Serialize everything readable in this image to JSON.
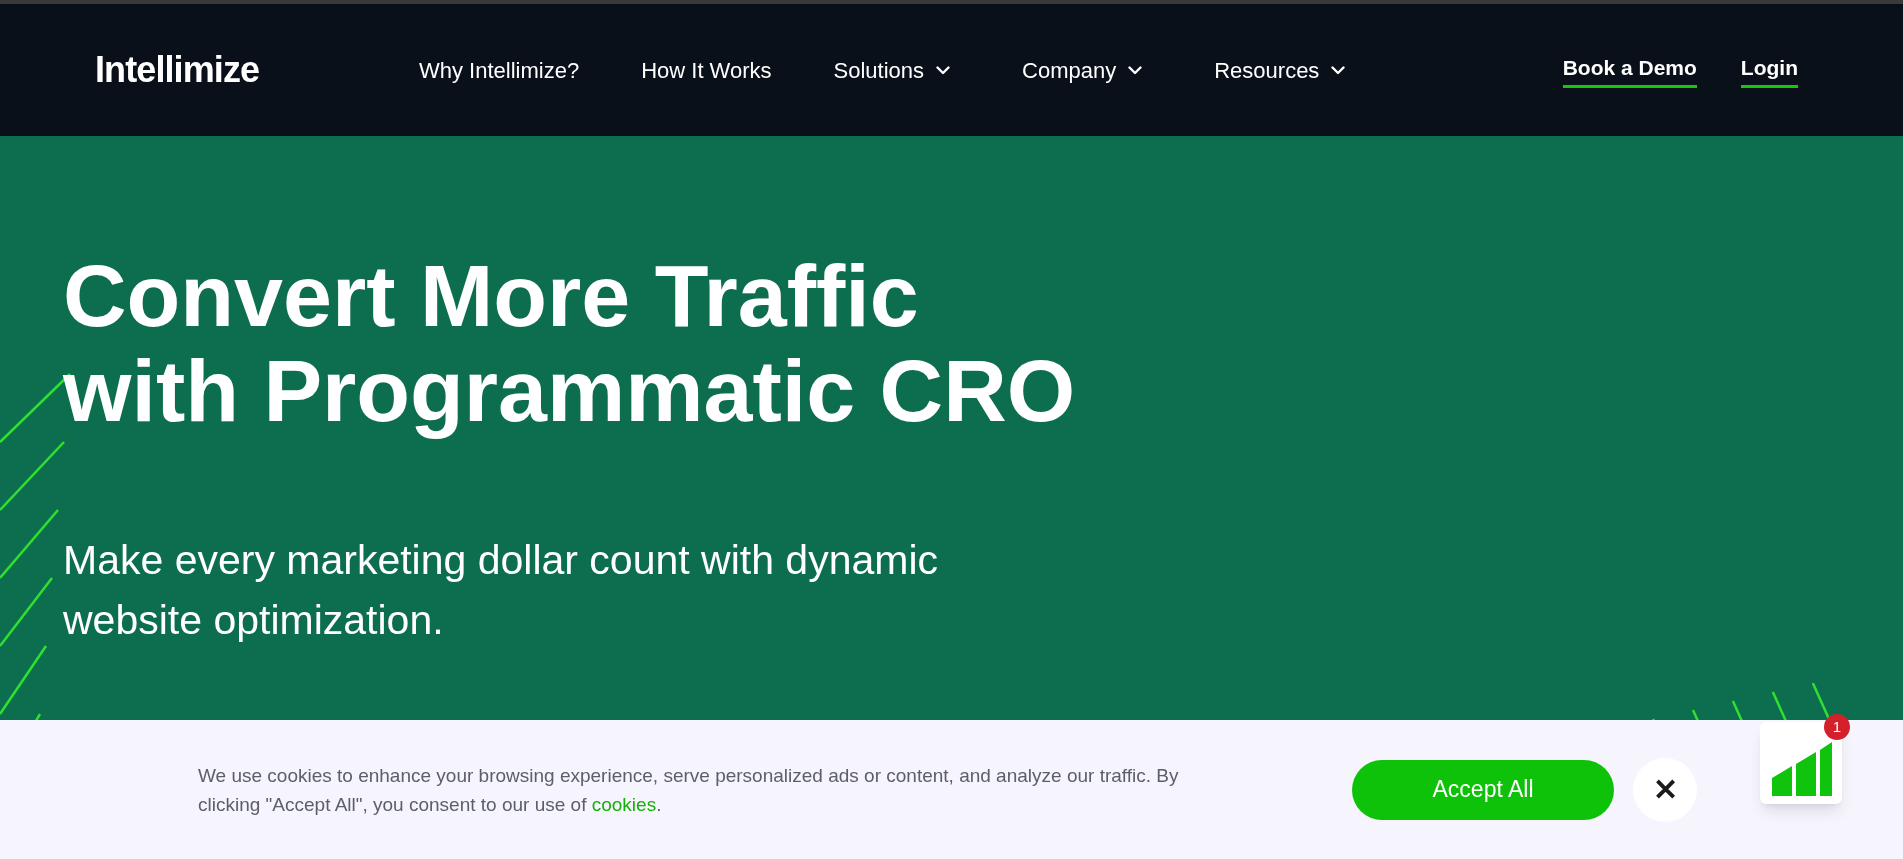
{
  "header": {
    "logo": "Intellimize",
    "nav": [
      {
        "label": "Why Intellimize?",
        "kind": "link"
      },
      {
        "label": "How It Works",
        "kind": "link"
      },
      {
        "label": "Solutions",
        "kind": "dropdown"
      },
      {
        "label": "Company",
        "kind": "dropdown"
      },
      {
        "label": "Resources",
        "kind": "dropdown"
      }
    ],
    "actions": [
      "Book a Demo",
      "Login"
    ]
  },
  "hero": {
    "title_lines": [
      "Convert More Traffic",
      "with Programmatic CRO"
    ],
    "subtitle_lines": [
      "Make every marketing dollar count with dynamic",
      "website optimization."
    ]
  },
  "cookie_banner": {
    "text": "We use cookies to enhance your browsing experience, serve personalized ads or content, and analyze our traffic. By clicking \"Accept All\", you consent to our use of",
    "link": "cookies",
    "after_link": ".",
    "accept_button": "Accept All",
    "close_icon": "✕"
  },
  "widget": {
    "badge": "1"
  }
}
